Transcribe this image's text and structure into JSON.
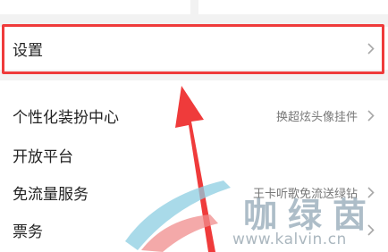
{
  "settings_row": {
    "label": "设置"
  },
  "menu": {
    "items": [
      {
        "label": "个性化装扮中心",
        "value": "换超炫头像挂件"
      },
      {
        "label": "开放平台",
        "value": ""
      },
      {
        "label": "免流量服务",
        "value": "王卡听歌免流送绿钻"
      },
      {
        "label": "票务",
        "value": ""
      }
    ]
  },
  "annotation": {
    "color": "#ef3b3b"
  },
  "watermark": {
    "text": "咖绿茵",
    "url": "www.kalvin.cn"
  }
}
